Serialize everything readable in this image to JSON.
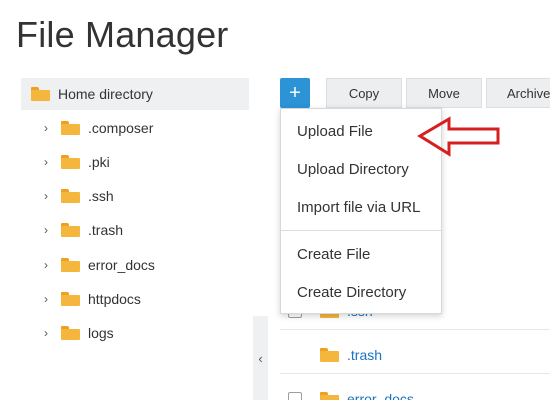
{
  "page": {
    "title": "File Manager"
  },
  "sidebar": {
    "root_label": "Home directory",
    "items": [
      {
        "label": ".composer"
      },
      {
        "label": ".pki"
      },
      {
        "label": ".ssh"
      },
      {
        "label": ".trash"
      },
      {
        "label": "error_docs"
      },
      {
        "label": "httpdocs"
      },
      {
        "label": "logs"
      }
    ],
    "collapse_glyph": "‹"
  },
  "toolbar": {
    "add_glyph": "+",
    "copy_label": "Copy",
    "move_label": "Move",
    "archive_label": "Archive"
  },
  "dropdown": {
    "items": [
      {
        "label": "Upload File"
      },
      {
        "label": "Upload Directory"
      },
      {
        "label": "Import file via URL"
      },
      {
        "label": "Create File"
      },
      {
        "label": "Create Directory"
      }
    ]
  },
  "file_list": {
    "rows": [
      {
        "name": ".ssh"
      },
      {
        "name": ".trash"
      },
      {
        "name": "error_docs"
      }
    ]
  },
  "colors": {
    "accent": "#2b93d6",
    "folder": "#f4b63d",
    "annotation_arrow": "#d62020"
  }
}
